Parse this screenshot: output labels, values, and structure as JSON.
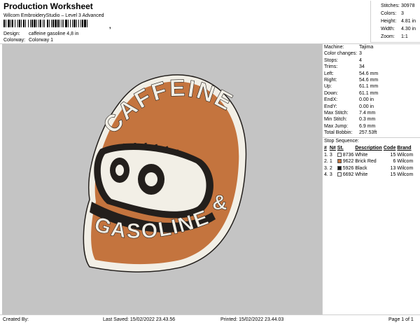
{
  "header": {
    "title": "Production Worksheet",
    "software": "Wilcom EmbroideryStudio – Level 3 Advanced",
    "design_label": "Design:",
    "design_value": "caffeine gasoline 4,8 in",
    "colorway_label": "Colorway:",
    "colorway_value": "Colorway 1"
  },
  "summary": [
    {
      "k": "Stitches:",
      "v": "30978"
    },
    {
      "k": "Colors:",
      "v": "3"
    },
    {
      "k": "Height:",
      "v": "4.81 in"
    },
    {
      "k": "Width:",
      "v": "4.30 in"
    },
    {
      "k": "Zoom:",
      "v": "1:1"
    }
  ],
  "machine_info": [
    {
      "k": "Machine:",
      "v": "Tajima"
    },
    {
      "k": "Color changes:",
      "v": "3"
    },
    {
      "k": "Stops:",
      "v": "4"
    },
    {
      "k": "Trims:",
      "v": "34"
    },
    {
      "k": "Left:",
      "v": "54.6 mm"
    },
    {
      "k": "Right:",
      "v": "54.6 mm"
    },
    {
      "k": "Up:",
      "v": "61.1 mm"
    },
    {
      "k": "Down:",
      "v": "61.1 mm"
    },
    {
      "k": "EndX:",
      "v": "0.00 in"
    },
    {
      "k": "EndY:",
      "v": "0.00 in"
    },
    {
      "k": "Max Stitch:",
      "v": "7.4 mm"
    },
    {
      "k": "Min Stitch:",
      "v": "0.3 mm"
    },
    {
      "k": "Max Jump:",
      "v": "6.9 mm"
    },
    {
      "k": "Total Bobbin:",
      "v": "257.53ft"
    }
  ],
  "stop_sequence": {
    "title": "Stop Sequence:",
    "headers": [
      "#",
      "N#",
      "St.",
      "Description",
      "Code",
      "Brand"
    ],
    "rows": [
      {
        "idx": "1.",
        "n": "3",
        "st": "8736",
        "color": "#ffffff",
        "desc": "White",
        "code": "15",
        "brand": "Wilcom"
      },
      {
        "idx": "2.",
        "n": "1",
        "st": "9622",
        "color": "#c4743e",
        "desc": "Brick Red",
        "code": "6",
        "brand": "Wilcom"
      },
      {
        "idx": "3.",
        "n": "2",
        "st": "5926",
        "color": "#1a1a1a",
        "desc": "Black",
        "code": "13",
        "brand": "Wilcom"
      },
      {
        "idx": "4.",
        "n": "3",
        "st": "6692",
        "color": "#ffffff",
        "desc": "White",
        "code": "15",
        "brand": "Wilcom"
      }
    ]
  },
  "design_art": {
    "word_top": "CAFFEINE",
    "word_amp": "&",
    "word_bottom": "GASOLINE",
    "colors": {
      "orange": "#c4743e",
      "white": "#f2efe6",
      "black": "#231f1c",
      "background": "#c4c4c4"
    }
  },
  "footer": {
    "created_by": "Created By:",
    "last_saved": "Last Saved: 15/02/2022 23.43.56",
    "printed": "Printed: 15/02/2022 23.44.03",
    "page": "Page 1 of 1"
  }
}
